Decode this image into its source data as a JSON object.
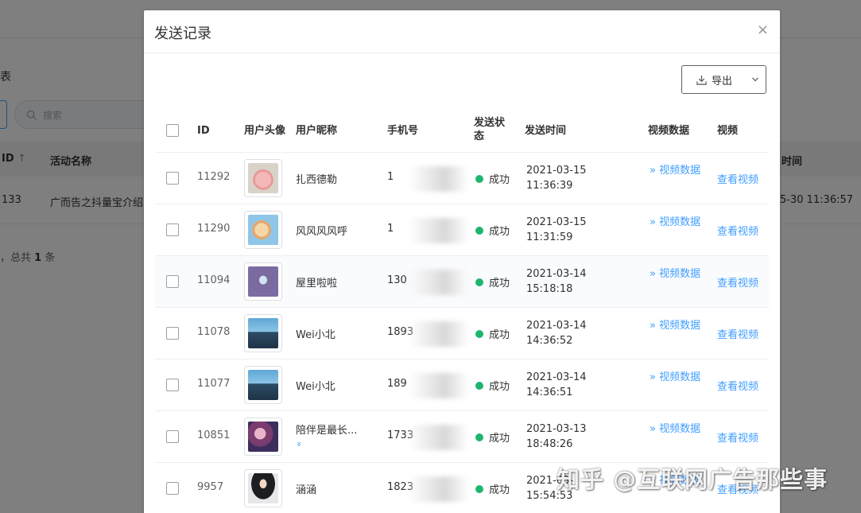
{
  "background": {
    "section_title": "表",
    "search_placeholder": "搜索",
    "table_headers": {
      "id": "ID",
      "sort_arrow": "↑",
      "activity_name": "活动名称",
      "time": "时间"
    },
    "row": {
      "id": "133",
      "activity_name": "广而告之抖量宝介绍",
      "time": "5-30 11:36:57"
    },
    "summary_prefix": "，总共",
    "summary_count": "1",
    "summary_suffix": "条"
  },
  "dialog": {
    "title": "发送记录",
    "close_icon": "×",
    "export_label": "导出",
    "table": {
      "headers": {
        "id": "ID",
        "avatar": "用户头像",
        "nickname": "用户昵称",
        "phone": "手机号",
        "status": "发送状态",
        "send_time": "发送时间",
        "video_data": "视频数据",
        "video": "视频"
      },
      "rows": [
        {
          "id": "11292",
          "nickname": "扎西德勒",
          "phone": "1",
          "status": "成功",
          "date": "2021-03-15",
          "time": "11:36:39",
          "video_data": "» 视频数据",
          "view": "查看视频"
        },
        {
          "id": "11290",
          "nickname": "风风风风呼",
          "phone": "1",
          "status": "成功",
          "date": "2021-03-15",
          "time": "11:31:59",
          "video_data": "» 视频数据",
          "view": "查看视频"
        },
        {
          "id": "11094",
          "nickname": "屋里啦啦",
          "phone": "130",
          "status": "成功",
          "date": "2021-03-14",
          "time": "15:18:18",
          "video_data": "» 视频数据",
          "view": "查看视频"
        },
        {
          "id": "11078",
          "nickname": "Wei小北",
          "phone": "1893",
          "status": "成功",
          "date": "2021-03-14",
          "time": "14:36:52",
          "video_data": "» 视频数据",
          "view": "查看视频"
        },
        {
          "id": "11077",
          "nickname": "Wei小北",
          "phone": "189",
          "status": "成功",
          "date": "2021-03-14",
          "time": "14:36:51",
          "video_data": "» 视频数据",
          "view": "查看视频"
        },
        {
          "id": "10851",
          "nickname": "陪伴是最长...",
          "nickname_more": "»",
          "phone": "1733",
          "status": "成功",
          "date": "2021-03-13",
          "time": "18:48:26",
          "video_data": "» 视频数据",
          "view": "查看视频"
        },
        {
          "id": "9957",
          "nickname": "涵涵",
          "phone": "1823",
          "status": "成功",
          "date": "2021-03-",
          "time": "15:54:53",
          "video_data": "» 视频数据",
          "view": "查看视频"
        }
      ]
    }
  },
  "watermark": "知乎 @互联网广告那些事",
  "colors": {
    "accent": "#409eff",
    "success": "#1fb56f",
    "overlay": "rgba(0,0,0,0.5)"
  }
}
